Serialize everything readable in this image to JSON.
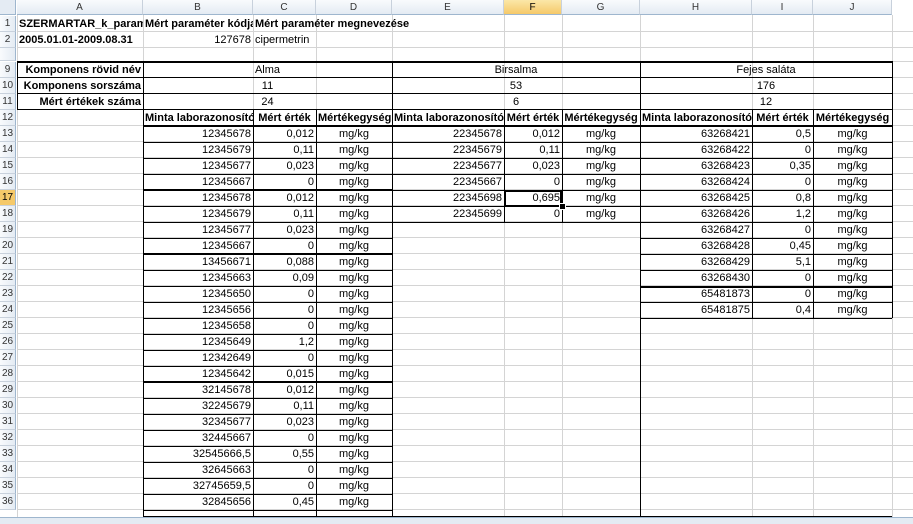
{
  "columns": [
    "A",
    "B",
    "C",
    "D",
    "E",
    "F",
    "G",
    "H",
    "I",
    "J"
  ],
  "selected_column": "F",
  "rows": [
    "1",
    "2",
    "9",
    "10",
    "11",
    "12",
    "13",
    "14",
    "15",
    "16",
    "17",
    "18",
    "19",
    "20",
    "21",
    "22",
    "23",
    "24",
    "25",
    "26",
    "27",
    "28",
    "29",
    "30",
    "31",
    "32",
    "33",
    "34",
    "35",
    "36"
  ],
  "selected_row": "17",
  "header": {
    "a1": "SZERMARTAR_k_paraméter",
    "b1": "Mért paraméter kódja",
    "c1": "Mért paraméter megnevezése",
    "a2": "2005.01.01-2009.08.31",
    "b2": "127678",
    "c2": "cipermetrin"
  },
  "labels": {
    "row9": "Komponens rövid név",
    "row10": "Komponens sorszáma",
    "row11": "Mért értékek száma"
  },
  "groups": [
    {
      "name": "Alma",
      "number": "11",
      "count": "24"
    },
    {
      "name": "Birsalma",
      "number": "53",
      "count": "6"
    },
    {
      "name": "Fejes saláta",
      "number": "176",
      "count": "12"
    }
  ],
  "subheaders": [
    "Minta laborazonosító",
    "Mért érték",
    "Mértékegység"
  ],
  "alma": [
    [
      "12345678",
      "0,012",
      "mg/kg"
    ],
    [
      "12345679",
      "0,11",
      "mg/kg"
    ],
    [
      "12345677",
      "0,023",
      "mg/kg"
    ],
    [
      "12345667",
      "0",
      "mg/kg"
    ],
    [
      "12345678",
      "0,012",
      "mg/kg"
    ],
    [
      "12345679",
      "0,11",
      "mg/kg"
    ],
    [
      "12345677",
      "0,023",
      "mg/kg"
    ],
    [
      "12345667",
      "0",
      "mg/kg"
    ],
    [
      "13456671",
      "0,088",
      "mg/kg"
    ],
    [
      "12345663",
      "0,09",
      "mg/kg"
    ],
    [
      "12345650",
      "0",
      "mg/kg"
    ],
    [
      "12345656",
      "0",
      "mg/kg"
    ],
    [
      "12345658",
      "0",
      "mg/kg"
    ],
    [
      "12345649",
      "1,2",
      "mg/kg"
    ],
    [
      "12342649",
      "0",
      "mg/kg"
    ],
    [
      "12345642",
      "0,015",
      "mg/kg"
    ],
    [
      "32145678",
      "0,012",
      "mg/kg"
    ],
    [
      "32245679",
      "0,11",
      "mg/kg"
    ],
    [
      "32345677",
      "0,023",
      "mg/kg"
    ],
    [
      "32445667",
      "0",
      "mg/kg"
    ],
    [
      "32545666,5",
      "0,55",
      "mg/kg"
    ],
    [
      "32645663",
      "0",
      "mg/kg"
    ],
    [
      "32745659,5",
      "0",
      "mg/kg"
    ],
    [
      "32845656",
      "0,45",
      "mg/kg"
    ]
  ],
  "birsalma": [
    [
      "22345678",
      "0,012",
      "mg/kg"
    ],
    [
      "22345679",
      "0,11",
      "mg/kg"
    ],
    [
      "22345677",
      "0,023",
      "mg/kg"
    ],
    [
      "22345667",
      "0",
      "mg/kg"
    ],
    [
      "22345698",
      "0,695",
      "mg/kg"
    ],
    [
      "22345699",
      "0",
      "mg/kg"
    ]
  ],
  "fejes": [
    [
      "63268421",
      "0,5",
      "mg/kg"
    ],
    [
      "63268422",
      "0",
      "mg/kg"
    ],
    [
      "63268423",
      "0,35",
      "mg/kg"
    ],
    [
      "63268424",
      "0",
      "mg/kg"
    ],
    [
      "63268425",
      "0,8",
      "mg/kg"
    ],
    [
      "63268426",
      "1,2",
      "mg/kg"
    ],
    [
      "63268427",
      "0",
      "mg/kg"
    ],
    [
      "63268428",
      "0,45",
      "mg/kg"
    ],
    [
      "63268429",
      "5,1",
      "mg/kg"
    ],
    [
      "63268430",
      "0",
      "mg/kg"
    ],
    [
      "65481873",
      "0",
      "mg/kg"
    ],
    [
      "65481875",
      "0,4",
      "mg/kg"
    ]
  ]
}
